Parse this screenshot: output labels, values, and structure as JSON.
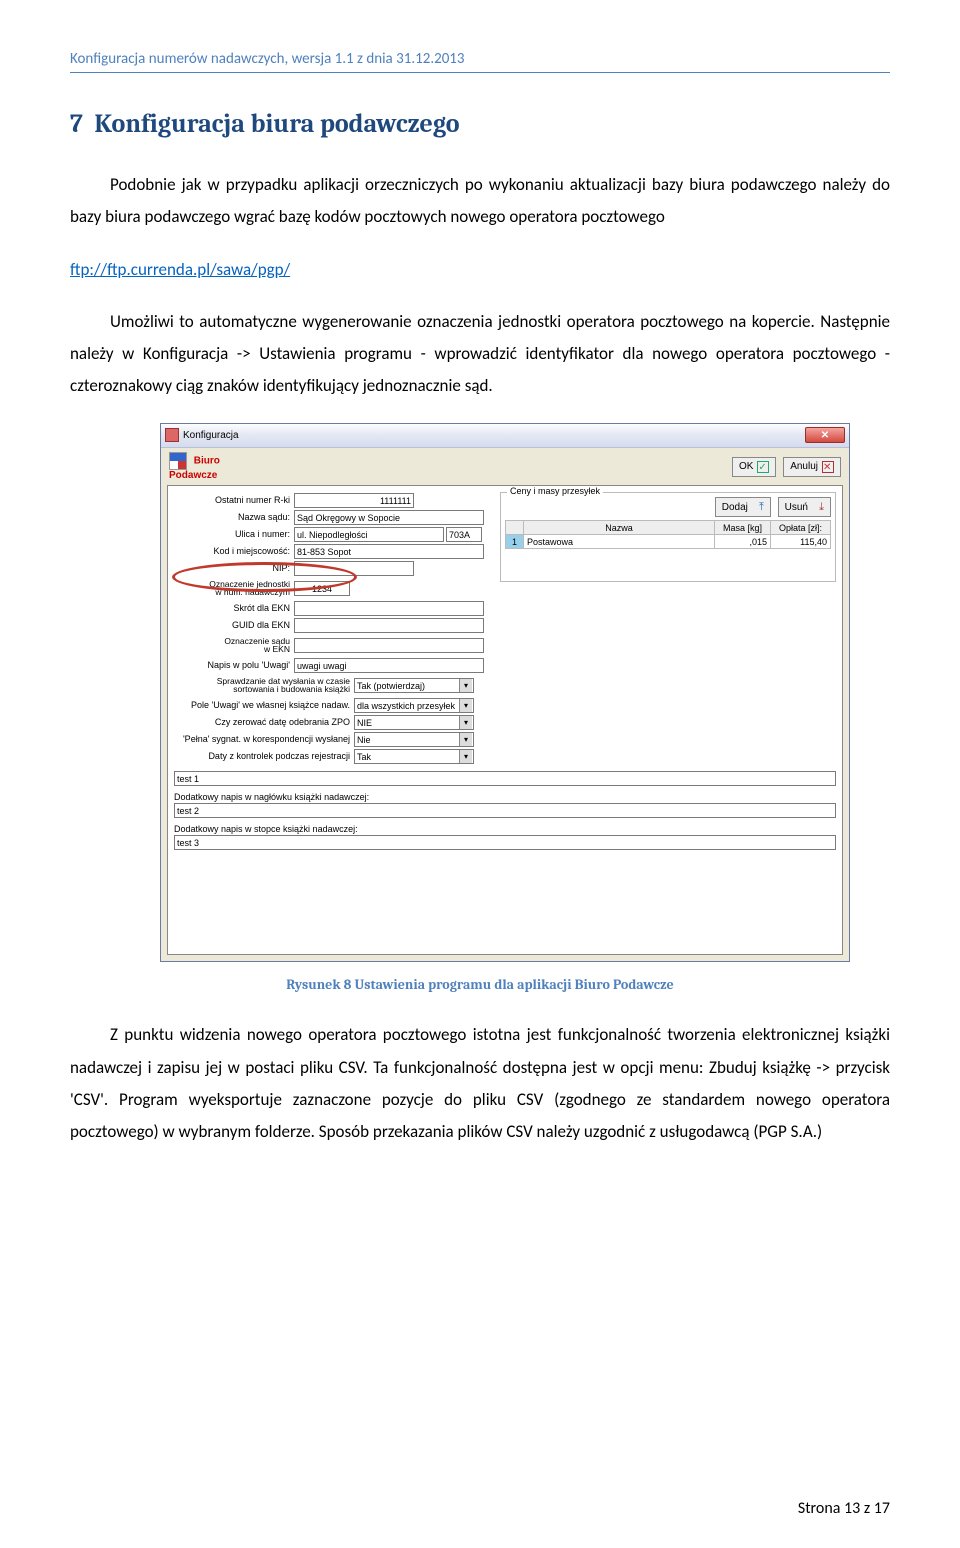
{
  "header_text": "Konfiguracja numerów nadawczych, wersja 1.1 z dnia 31.12.2013",
  "section_number": "7",
  "section_title": "Konfiguracja biura podawczego",
  "para1": "Podobnie jak w przypadku aplikacji orzeczniczych po wykonaniu aktualizacji bazy biura podawczego należy do bazy biura podawczego wgrać bazę kodów pocztowych nowego operatora pocztowego",
  "link_text": "ftp://ftp.currenda.pl/sawa/pgp/",
  "para2": "Umożliwi to automatyczne wygenerowanie oznaczenia jednostki operatora pocztowego na kopercie. Następnie należy w Konfiguracja -> Ustawienia programu - wprowadzić identyfikator dla nowego operatora pocztowego - czteroznakowy ciąg znaków identyfikujący jednoznacznie sąd.",
  "caption": "Rysunek 8 Ustawienia programu dla aplikacji Biuro Podawcze",
  "para3": "Z punktu widzenia nowego operatora pocztowego istotna jest funkcjonalność tworzenia elektronicznej książki nadawczej i zapisu jej w postaci pliku CSV. Ta funkcjonalność dostępna jest w opcji menu: Zbuduj książkę -> przycisk 'CSV'. Program wyeksportuje zaznaczone pozycje do pliku CSV (zgodnego ze standardem nowego operatora pocztowego) w wybranym folderze. Sposób przekazania plików CSV należy uzgodnić z usługodawcą (PGP S.A.)",
  "footer": "Strona 13 z 17",
  "win": {
    "title": "Konfiguracja",
    "subtitle1": "Biuro",
    "subtitle2": "Podawcze",
    "btn_ok": "OK",
    "btn_anuluj": "Anuluj",
    "left": {
      "ostatni_label": "Ostatni numer R-ki",
      "ostatni_value": "1111111",
      "nazwa_sadu_label": "Nazwa sądu:",
      "nazwa_sadu_value": "Sąd Okręgowy w Sopocie",
      "ulica_label": "Ulica i numer:",
      "ulica_value": "ul. Niepodległości",
      "ulica_num": "703A",
      "kod_label": "Kod i miejscowość:",
      "kod_value": "81-853  Sopot",
      "nip_label": "NIP:",
      "ozn_label1": "Oznaczenie jednostki",
      "ozn_label2": "w num. nadawczym",
      "ozn_value": "1234",
      "skrot_label": "Skrót dla EKN",
      "guid_label": "GUID dla EKN",
      "oznsad_label1": "Oznaczenie sądu",
      "oznsad_label2": "w EKN",
      "napis_label": "Napis w polu 'Uwagi'",
      "napis_value": "uwagi uwagi",
      "sprawdz_label1": "Sprawdzanie dat wysłania w czasie",
      "sprawdz_label2": "sortowania i budowania książki",
      "sprawdz_value": "Tak (potwierdzaj)",
      "pole_label": "Pole 'Uwagi' we własnej książce nadaw.",
      "pole_value": "dla wszystkich przesyłek",
      "zerowac_label": "Czy zerować datę odebrania ZPO",
      "zerowac_value": "NIE",
      "pelna_label": "'Pełna' sygnat. w korespondencji wysłanej",
      "pelna_value": "Nie",
      "daty_label": "Daty z kontrolek podczas rejestracji",
      "daty_value": "Tak",
      "test1": "test 1",
      "dod1_label": "Dodatkowy napis w nagłówku książki nadawczej:",
      "test2": "test 2",
      "dod2_label": "Dodatkowy napis w stopce książki nadawczej:",
      "test3": "test 3"
    },
    "right": {
      "ceny_title": "Ceny i masy przesyłek",
      "btn_dodaj": "Dodaj",
      "btn_usun": "Usuń",
      "col_nazwa": "Nazwa",
      "col_masa": "Masa [kg]",
      "col_oplata": "Opłata [zł]:",
      "row_num": "1",
      "row_nazwa": "Postawowa",
      "row_masa": ",015",
      "row_oplata": "115,40"
    }
  }
}
